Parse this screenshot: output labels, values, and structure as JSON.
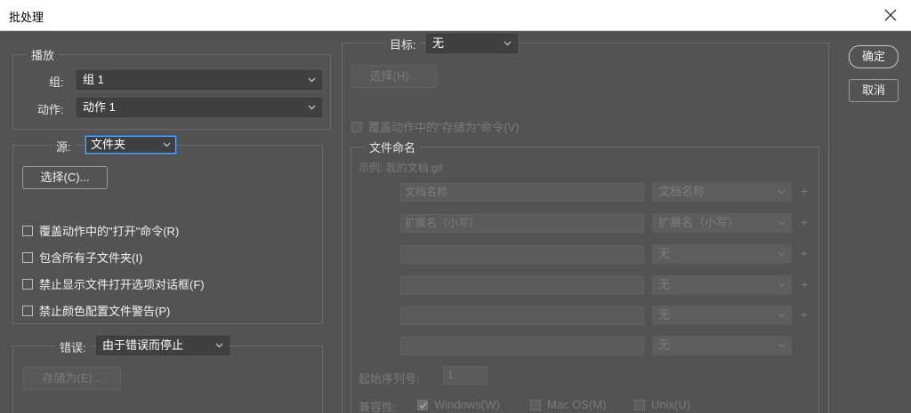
{
  "window": {
    "title": "批处理"
  },
  "buttons": {
    "ok": "确定",
    "cancel": "取消"
  },
  "play": {
    "legend": "播放",
    "group_label": "组:",
    "group_value": "组 1",
    "action_label": "动作:",
    "action_value": "动作 1"
  },
  "source": {
    "label": "源:",
    "value": "文件夹",
    "choose_button": "选择(C)...",
    "options": [
      {
        "label": "覆盖动作中的\"打开\"命令(R)",
        "checked": false
      },
      {
        "label": "包含所有子文件夹(I)",
        "checked": false
      },
      {
        "label": "禁止显示文件打开选项对话框(F)",
        "checked": false
      },
      {
        "label": "禁止颜色配置文件警告(P)",
        "checked": false
      }
    ]
  },
  "errors": {
    "label": "错误:",
    "value": "由于错误而停止",
    "save_as_button": "存储为(E)..."
  },
  "destination": {
    "label": "目标:",
    "value": "无",
    "choose_button": "选择(H)...",
    "override_save": "覆盖动作中的\"存储为\"命令(V)"
  },
  "naming": {
    "legend": "文件命名",
    "example": "示例: 我的文档.gif",
    "rows": [
      {
        "field": "文档名称",
        "select": "文档名称"
      },
      {
        "field": "扩展名（小写）",
        "select": "扩展名（小写）"
      },
      {
        "field": "",
        "select": "无"
      },
      {
        "field": "",
        "select": "无"
      },
      {
        "field": "",
        "select": "无"
      },
      {
        "field": "",
        "select": "无"
      }
    ],
    "serial_label": "起始序列号:",
    "serial_value": "1",
    "compat_label": "兼容性:",
    "compat": [
      {
        "label": "Windows(W)",
        "checked": true
      },
      {
        "label": "Mac OS(M)",
        "checked": false
      },
      {
        "label": "Unix(U)",
        "checked": false
      }
    ]
  },
  "colors": {
    "background": "#535353",
    "focus": "#2e72c8"
  }
}
